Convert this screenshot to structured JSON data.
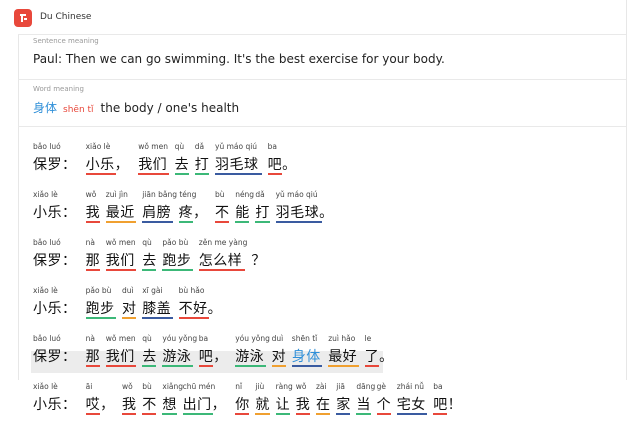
{
  "app": {
    "title": "Du Chinese"
  },
  "sentence": {
    "label": "Sentence meaning",
    "text": "Paul: Then we can go swimming. It's the best exercise for your body."
  },
  "word": {
    "label": "Word meaning",
    "hanzi": "身体",
    "pinyin": "shēn tǐ",
    "definition": "the body / one's health"
  },
  "colors": {
    "accent": "#e8483b",
    "blue": "#2f8fd8",
    "red": "#e8483b",
    "green": "#3cb878",
    "orange": "#f0a030",
    "navy": "#3a5ba0"
  },
  "dialog": [
    {
      "segs": [
        {
          "py": "bǎo luó",
          "hz": "保罗："
        },
        {
          "py": "xiǎo lè",
          "hz": "小乐，",
          "ul": "#e8483b"
        },
        {
          "py": "wǒ men",
          "hz": "我们",
          "ul": "#e8483b"
        },
        {
          "py": "qù",
          "hz": "去",
          "ul": "#3cb878"
        },
        {
          "py": "dǎ",
          "hz": "打",
          "ul": "#3cb878"
        },
        {
          "py": "yǔ máo qiú",
          "hz": "羽毛球",
          "ul": "#3a5ba0"
        },
        {
          "py": "ba",
          "hz": "吧。",
          "ul": "#e8483b"
        }
      ]
    },
    {
      "segs": [
        {
          "py": "xiǎo lè",
          "hz": "小乐："
        },
        {
          "py": "wǒ",
          "hz": "我",
          "ul": "#e8483b"
        },
        {
          "py": "zuì jìn",
          "hz": "最近",
          "ul": "#f0a030"
        },
        {
          "py": "jiān bǎng téng",
          "hz": "肩膀",
          "ul": "#3a5ba0"
        },
        {
          "py": "",
          "hz": "疼，",
          "ul": "#3cb878"
        },
        {
          "py": "bù",
          "hz": "不",
          "ul": "#e8483b"
        },
        {
          "py": "néng",
          "hz": "能",
          "ul": "#3cb878"
        },
        {
          "py": "dǎ",
          "hz": "打",
          "ul": "#3cb878"
        },
        {
          "py": "yǔ máo qiú",
          "hz": "羽毛球。",
          "ul": "#3a5ba0"
        }
      ]
    },
    {
      "segs": [
        {
          "py": "bǎo luó",
          "hz": "保罗："
        },
        {
          "py": "nà",
          "hz": "那",
          "ul": "#e8483b"
        },
        {
          "py": "wǒ men",
          "hz": "我们",
          "ul": "#e8483b"
        },
        {
          "py": "qù",
          "hz": "去",
          "ul": "#3cb878"
        },
        {
          "py": "pǎo bù",
          "hz": "跑步",
          "ul": "#3cb878"
        },
        {
          "py": "zěn me yàng",
          "hz": "怎么样",
          "ul": "#e8483b"
        },
        {
          "py": "",
          "hz": "？"
        }
      ]
    },
    {
      "segs": [
        {
          "py": "xiǎo lè",
          "hz": "小乐："
        },
        {
          "py": "pǎo bù",
          "hz": "跑步",
          "ul": "#3cb878"
        },
        {
          "py": "duì",
          "hz": "对",
          "ul": "#f0a030"
        },
        {
          "py": "xī gài",
          "hz": "膝盖",
          "ul": "#3a5ba0"
        },
        {
          "py": "bù hǎo",
          "hz": "不好。",
          "ul": "#e8483b"
        }
      ]
    },
    {
      "highlight": true,
      "segs": [
        {
          "py": "bǎo luó",
          "hz": "保罗："
        },
        {
          "py": "nà",
          "hz": "那",
          "ul": "#e8483b"
        },
        {
          "py": "wǒ men",
          "hz": "我们",
          "ul": "#e8483b"
        },
        {
          "py": "qù",
          "hz": "去",
          "ul": "#3cb878"
        },
        {
          "py": "yóu yǒng",
          "hz": "游泳",
          "ul": "#3cb878"
        },
        {
          "py": "ba",
          "hz": "吧，",
          "ul": "#e8483b"
        },
        {
          "py": "yóu yǒng",
          "hz": "游泳",
          "ul": "#3cb878"
        },
        {
          "py": "duì",
          "hz": "对",
          "ul": "#f0a030"
        },
        {
          "py": "shēn tǐ",
          "hz": "身体",
          "blue": true,
          "ul": "#3a5ba0"
        },
        {
          "py": "zuì hǎo",
          "hz": "最好",
          "ul": "#f0a030"
        },
        {
          "py": "le",
          "hz": "了。",
          "ul": "#e8483b"
        }
      ]
    },
    {
      "segs": [
        {
          "py": "xiǎo lè",
          "hz": "小乐："
        },
        {
          "py": "āi",
          "hz": "哎，",
          "ul": "#e8483b"
        },
        {
          "py": "wǒ",
          "hz": "我",
          "ul": "#e8483b"
        },
        {
          "py": "bù",
          "hz": "不",
          "ul": "#e8483b"
        },
        {
          "py": "xiǎng",
          "hz": "想",
          "ul": "#3cb878"
        },
        {
          "py": "chū mén",
          "hz": "出门，",
          "ul": "#3cb878"
        },
        {
          "py": "nǐ",
          "hz": "你",
          "ul": "#e8483b"
        },
        {
          "py": "jiù",
          "hz": "就",
          "ul": "#f0a030"
        },
        {
          "py": "ràng",
          "hz": "让",
          "ul": "#3cb878"
        },
        {
          "py": "wǒ",
          "hz": "我",
          "ul": "#e8483b"
        },
        {
          "py": "zài",
          "hz": "在",
          "ul": "#f0a030"
        },
        {
          "py": "jiā",
          "hz": "家",
          "ul": "#3a5ba0"
        },
        {
          "py": "dāng",
          "hz": "当",
          "ul": "#3cb878"
        },
        {
          "py": "gè",
          "hz": "个",
          "ul": "#e8483b"
        },
        {
          "py": "zhái nǚ",
          "hz": "宅女",
          "ul": "#3a5ba0"
        },
        {
          "py": "ba",
          "hz": "吧！",
          "ul": "#e8483b"
        }
      ]
    }
  ]
}
